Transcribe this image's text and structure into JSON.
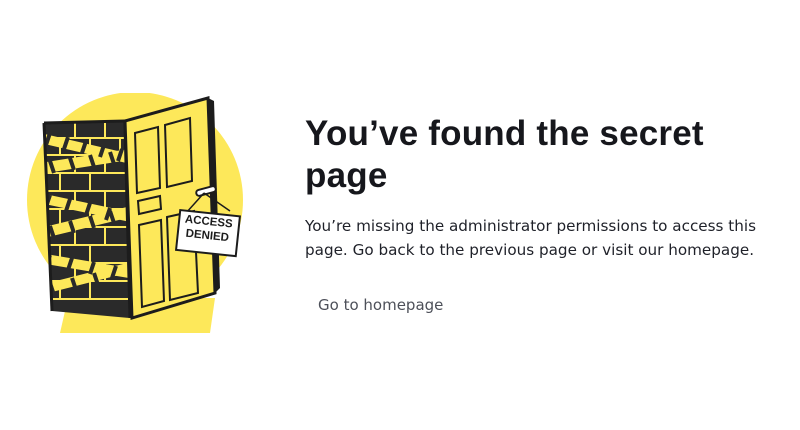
{
  "illustration": {
    "sign_line1": "ACCESS",
    "sign_line2": "DENIED",
    "icon": "access-denied-door-illustration"
  },
  "error": {
    "title": "You’ve found the secret page",
    "description": "You’re missing the administrator permissions to access this page. Go back to the previous page or visit our homepage."
  },
  "actions": {
    "home_label": "Go to homepage"
  },
  "colors": {
    "accent_yellow": "#fde85a",
    "text_dark": "#16171c",
    "link_gray": "#4d5059"
  }
}
